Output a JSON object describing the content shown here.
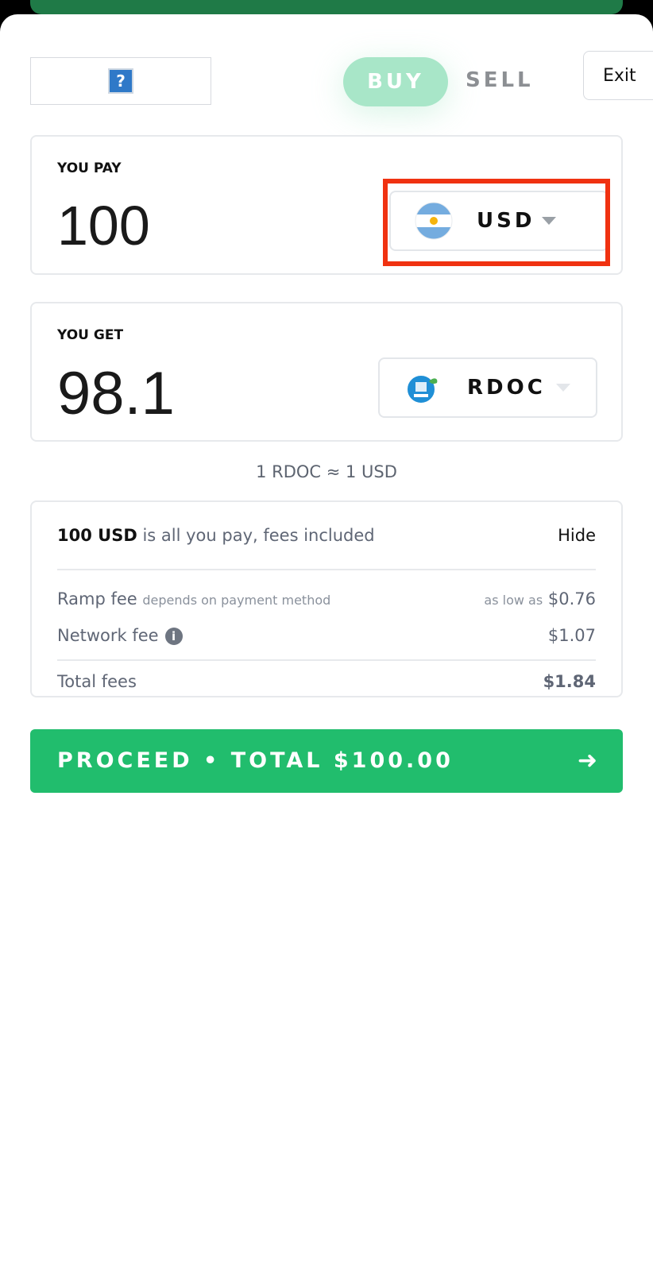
{
  "header": {
    "logo_placeholder_glyph": "?",
    "tabs": [
      {
        "label": "BUY",
        "active": true
      },
      {
        "label": "SELL",
        "active": false
      }
    ],
    "exit_label": "Exit"
  },
  "pay": {
    "label": "YOU PAY",
    "amount": "100",
    "currency": "USD",
    "flag_icon": "argentina-flag-icon"
  },
  "get": {
    "label": "YOU GET",
    "amount": "98.1",
    "currency": "RDOC",
    "token_icon": "rdoc-dollar-token-icon"
  },
  "rate": "1 RDOC ≈ 1 USD",
  "fees": {
    "summary_amount": "100 USD",
    "summary_text": " is all you pay, fees included",
    "toggle_label": "Hide",
    "ramp_fee_label": "Ramp fee",
    "ramp_fee_note": "depends on payment method",
    "ramp_fee_prefix": "as low as",
    "ramp_fee_value": "$0.76",
    "network_fee_label": "Network fee",
    "network_fee_value": "$1.07",
    "total_label": "Total fees",
    "total_value": "$1.84"
  },
  "proceed": {
    "label": "PROCEED • TOTAL $100.00",
    "arrow": "➜"
  },
  "colors": {
    "brand_green": "#21bd6d",
    "tab_active": "#a8e6c8",
    "highlight_red": "#f03211"
  }
}
